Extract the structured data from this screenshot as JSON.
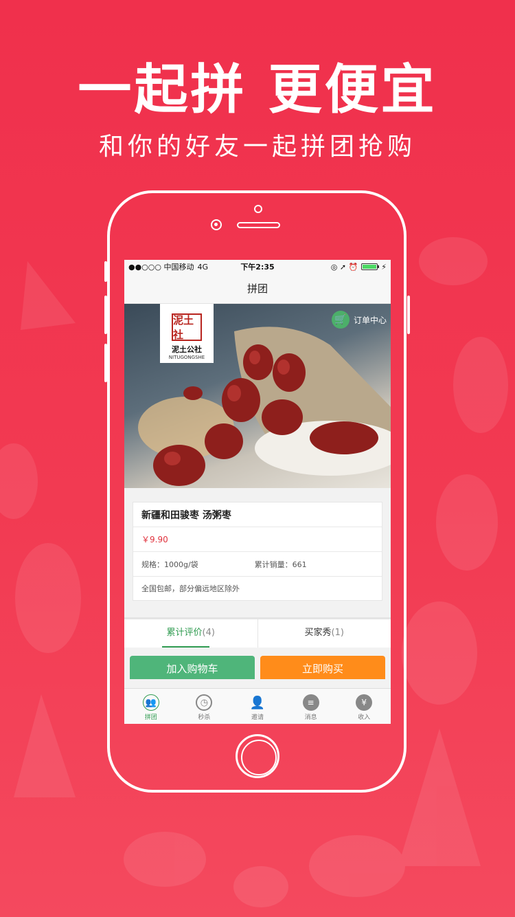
{
  "promo": {
    "headline": "一起拼 更便宜",
    "subheadline": "和你的好友一起拼团抢购"
  },
  "status_bar": {
    "carrier": "●●○○○ 中国移动",
    "network": "4G",
    "time": "下午2:35",
    "icons": "◎ ➚ ⏰",
    "battery_level": 1.0
  },
  "navbar": {
    "title": "拼团"
  },
  "banner": {
    "logo_seal": "泥土社",
    "logo_name": "泥土公社",
    "logo_en": "NITUGONGSHE",
    "order_center_label": "订单中心",
    "order_icon": "cart-icon"
  },
  "product": {
    "title": "新疆和田骏枣 汤粥枣",
    "price": "￥9.90",
    "spec": "规格：1000g/袋",
    "sales": "累计销量：661",
    "shipping": "全国包邮，部分偏远地区除外"
  },
  "tabs": [
    {
      "label": "累计评价",
      "count": "(4)"
    },
    {
      "label": "买家秀",
      "count": "(1)"
    }
  ],
  "actions": {
    "add_to_cart": "加入购物车",
    "buy_now": "立即购买"
  },
  "tabbar": [
    {
      "label": "拼团",
      "icon": "group-icon"
    },
    {
      "label": "秒杀",
      "icon": "clock-icon"
    },
    {
      "label": "邀请",
      "icon": "add-user-icon"
    },
    {
      "label": "消息",
      "icon": "chat-icon"
    },
    {
      "label": "收入",
      "icon": "money-bag-icon"
    }
  ],
  "colors": {
    "background": "#f0304c",
    "accent_green": "#2f9b50",
    "cart_button": "#4fb57a",
    "buy_button": "#ff8c1a",
    "price": "#e0313c"
  }
}
